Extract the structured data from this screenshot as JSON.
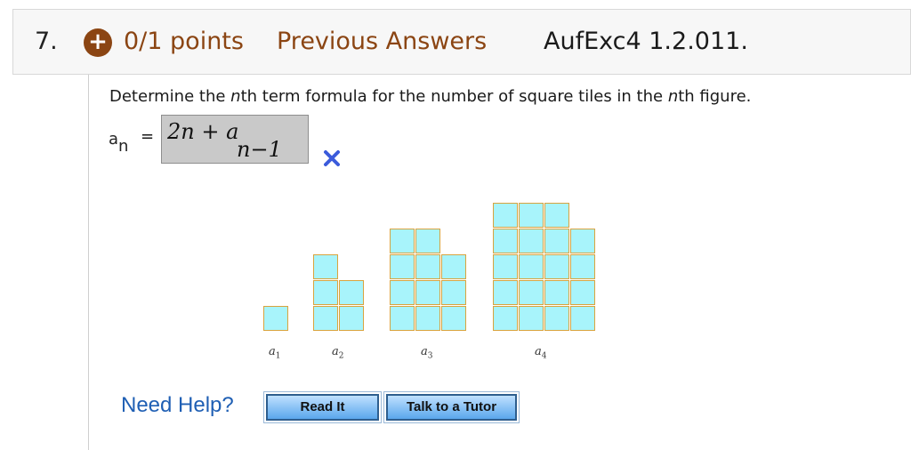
{
  "header": {
    "number": "7.",
    "plus_icon": "+",
    "points": "0/1 points",
    "previous_answers": "Previous Answers",
    "code": "AufExc4 1.2.011."
  },
  "question": {
    "prefix": "Determine the ",
    "n1": "n",
    "middle": "th term formula for the number of square tiles in the ",
    "n2": "n",
    "suffix": "th figure."
  },
  "answer": {
    "label_a": "a",
    "label_n": "n",
    "equals": "=",
    "expr_main": "2n + a",
    "expr_sub": "n−1",
    "status_icon": "incorrect-x-icon",
    "status_color": "#3b5bdb"
  },
  "figures": {
    "labels": [
      {
        "base": "a",
        "sub": "1"
      },
      {
        "base": "a",
        "sub": "2"
      },
      {
        "base": "a",
        "sub": "3"
      },
      {
        "base": "a",
        "sub": "4"
      }
    ],
    "column_heights": [
      [
        1
      ],
      [
        3,
        2
      ],
      [
        4,
        4,
        3
      ],
      [
        5,
        5,
        5,
        4
      ]
    ],
    "tile_color": "#a8f4fb",
    "tile_border": "#d9a33e"
  },
  "help": {
    "need_help": "Need Help?",
    "read_it": "Read It",
    "talk_to_tutor": "Talk to a Tutor"
  }
}
